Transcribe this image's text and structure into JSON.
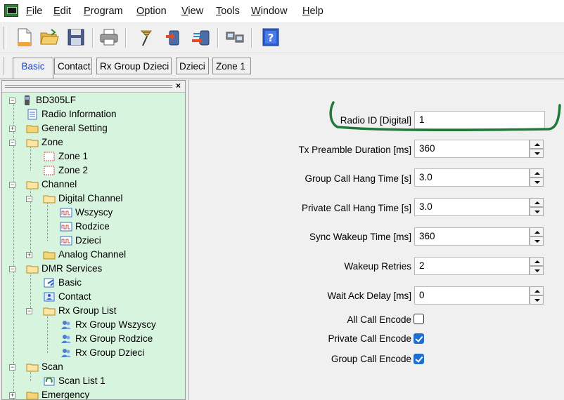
{
  "menu": {
    "items": [
      {
        "accel": "F",
        "rest": "ile"
      },
      {
        "accel": "E",
        "rest": "dit"
      },
      {
        "accel": "P",
        "rest": "rogram"
      },
      {
        "accel": "O",
        "rest": "ption"
      },
      {
        "accel": "V",
        "rest": "iew"
      },
      {
        "accel": "T",
        "rest": "ools"
      },
      {
        "accel": "W",
        "rest": "indow"
      },
      {
        "accel": "H",
        "rest": "elp"
      }
    ]
  },
  "toolbar": {
    "icons": [
      "new-file-icon",
      "open-folder-icon",
      "save-icon",
      "print-icon",
      "read-radio-icon",
      "write-radio-icon",
      "transfer-icon",
      "network-icon",
      "help-icon"
    ]
  },
  "tabs": [
    "Basic",
    "Contact",
    "Rx Group Dzieci",
    "Dzieci",
    "Zone 1"
  ],
  "tree": {
    "close": "×",
    "nodes": [
      {
        "label": "BD305LF"
      },
      {
        "label": "Radio Information"
      },
      {
        "label": "General Setting"
      },
      {
        "label": "Zone"
      },
      {
        "label": "Zone 1"
      },
      {
        "label": "Zone 2"
      },
      {
        "label": "Channel"
      },
      {
        "label": "Digital Channel"
      },
      {
        "label": "Wszyscy"
      },
      {
        "label": "Rodzice"
      },
      {
        "label": "Dzieci"
      },
      {
        "label": "Analog Channel"
      },
      {
        "label": "DMR Services"
      },
      {
        "label": "Basic"
      },
      {
        "label": "Contact"
      },
      {
        "label": "Rx Group List"
      },
      {
        "label": "Rx Group Wszyscy"
      },
      {
        "label": "Rx Group Rodzice"
      },
      {
        "label": "Rx Group Dzieci"
      },
      {
        "label": "Scan"
      },
      {
        "label": "Scan List 1"
      },
      {
        "label": "Emergency"
      }
    ]
  },
  "form": {
    "fields": [
      {
        "label": "Radio ID [Digital]",
        "value": "1"
      },
      {
        "label": "Tx Preamble Duration [ms]",
        "value": "360"
      },
      {
        "label": "Group Call Hang Time [s]",
        "value": "3.0"
      },
      {
        "label": "Private Call Hang Time [s]",
        "value": "3.0"
      },
      {
        "label": "Sync Wakeup Time [ms]",
        "value": "360"
      },
      {
        "label": "Wakeup Retries",
        "value": "2"
      },
      {
        "label": "Wait Ack Delay [ms]",
        "value": "0"
      }
    ],
    "checkboxes": [
      {
        "label": "All Call Encode",
        "checked": false
      },
      {
        "label": "Private Call Encode",
        "checked": true
      },
      {
        "label": "Group Call Encode",
        "checked": true
      }
    ]
  },
  "colors": {
    "tree_bg": "#d7f5de",
    "active_tab": "#1a3fbf",
    "checkbox_on": "#1e6fd0",
    "annotation": "#1f7a3a"
  }
}
